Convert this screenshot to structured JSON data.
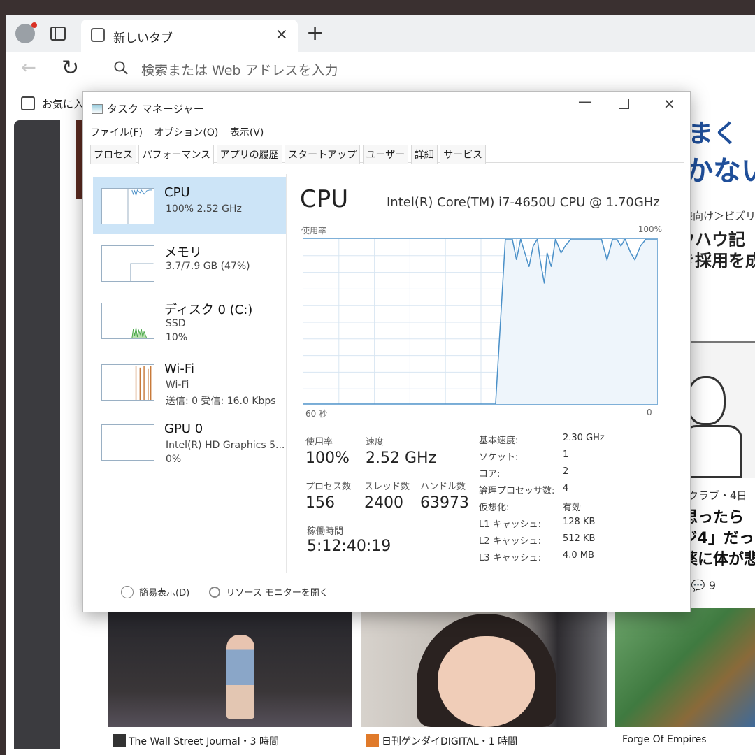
{
  "browser": {
    "tab_title": "新しいタブ",
    "tab_close": "×",
    "new_tab": "+",
    "address_placeholder": "検索または Web アドレスを入力",
    "favorites_label": "お気に入"
  },
  "background": {
    "headline_1": "まく",
    "headline_2": "かない",
    "breadcrumb": "様向け＞ビズリ",
    "article_title_lines": [
      "ウハウ記",
      "き採用を成",
      "？"
    ],
    "source_2": "タスクラブ・4日",
    "article_2_lines": [
      "と思ったら",
      "ージ4」だった",
      "い薬に体が悲"
    ],
    "actions": "32   ♡   💬 9",
    "cards": [
      {
        "source": "The Wall Street Journal・3 時間"
      },
      {
        "source": "日刊ゲンダイDIGITAL・1 時間"
      },
      {
        "source": "Forge Of Empires"
      }
    ]
  },
  "taskmanager": {
    "title": "タスク マネージャー",
    "menu": [
      "ファイル(F)",
      "オプション(O)",
      "表示(V)"
    ],
    "tabs": [
      "プロセス",
      "パフォーマンス",
      "アプリの履歴",
      "スタートアップ",
      "ユーザー",
      "詳細",
      "サービス"
    ],
    "active_tab_index": 1,
    "sidebar": [
      {
        "name": "CPU",
        "sub1": "100%  2.52 GHz",
        "sub2": ""
      },
      {
        "name": "メモリ",
        "sub1": "3.7/7.9 GB (47%)",
        "sub2": ""
      },
      {
        "name": "ディスク 0 (C:)",
        "sub1": "SSD",
        "sub2": "10%"
      },
      {
        "name": "Wi-Fi",
        "sub1": "Wi-Fi",
        "sub2": "送信: 0 受信: 16.0 Kbps"
      },
      {
        "name": "GPU 0",
        "sub1": "Intel(R) HD Graphics 5...",
        "sub2": "0%"
      }
    ],
    "main": {
      "title": "CPU",
      "model": "Intel(R) Core(TM) i7-4650U CPU @ 1.70GHz",
      "graph_label_top_left": "使用率",
      "graph_label_top_right": "100%",
      "graph_label_bottom_left": "60 秒",
      "graph_label_bottom_right": "0",
      "stats": {
        "usage_label": "使用率",
        "usage_value": "100%",
        "speed_label": "速度",
        "speed_value": "2.52 GHz",
        "process_label": "プロセス数",
        "process_value": "156",
        "thread_label": "スレッド数",
        "thread_value": "2400",
        "handle_label": "ハンドル数",
        "handle_value": "63973",
        "uptime_label": "稼働時間",
        "uptime_value": "5:12:40:19"
      },
      "specs": [
        {
          "key": "基本速度:",
          "value": "2.30 GHz"
        },
        {
          "key": "ソケット:",
          "value": "1"
        },
        {
          "key": "コア:",
          "value": "2"
        },
        {
          "key": "論理プロセッサ数:",
          "value": "4"
        },
        {
          "key": "仮想化:",
          "value": "有効"
        },
        {
          "key": "L1 キャッシュ:",
          "value": "128 KB"
        },
        {
          "key": "L2 キャッシュ:",
          "value": "512 KB"
        },
        {
          "key": "L3 キャッシュ:",
          "value": "4.0 MB"
        }
      ]
    },
    "footer": {
      "fewer_details": "簡易表示(D)",
      "resource_monitor": "リソース モニターを開く"
    },
    "colors": {
      "selected": "#cce4f7",
      "graph_line": "#4a90c8",
      "disk_line": "#4aa84a",
      "wifi_line": "#c87a3a"
    }
  }
}
